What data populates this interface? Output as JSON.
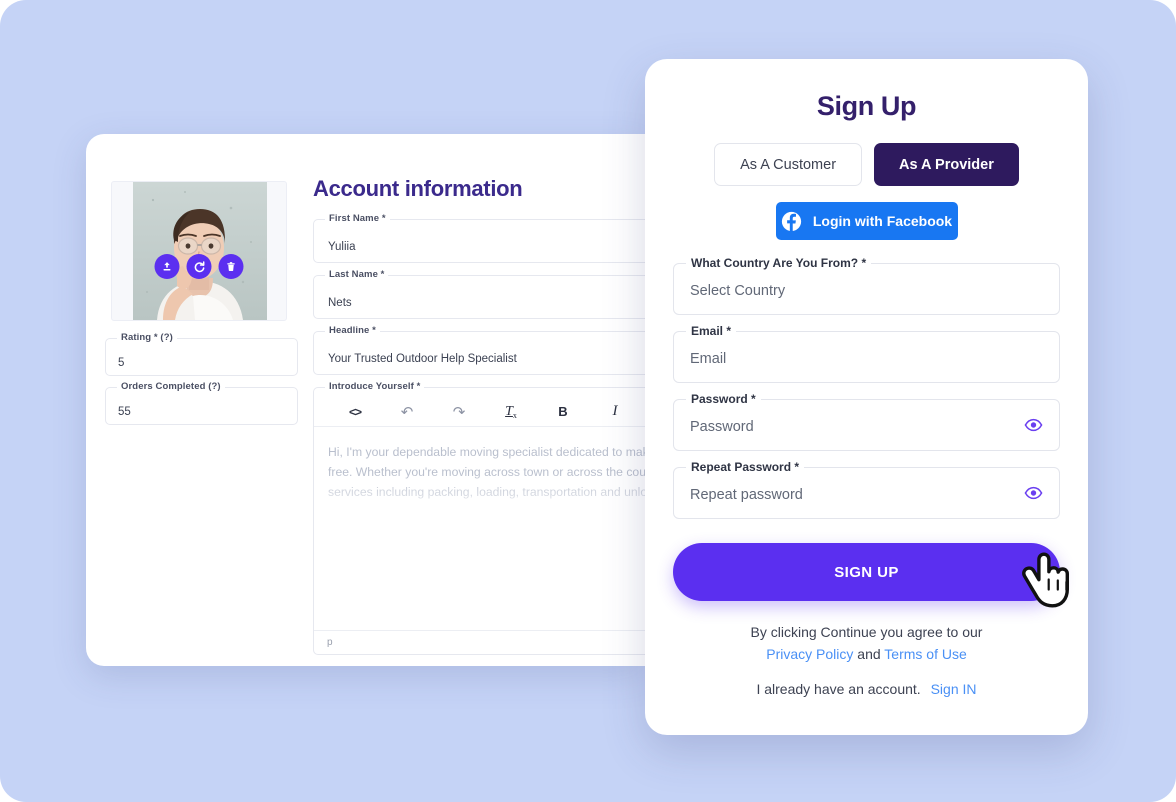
{
  "theme": {
    "backdrop": "#c5d3f6",
    "accent_purple": "#5b2ff0",
    "dark_indigo": "#2e1a5e",
    "title_indigo": "#34206b",
    "facebook_blue": "#1877f2",
    "link_blue": "#4a90f5"
  },
  "back_card": {
    "title": "Account information",
    "avatar": {
      "alt": "profile-photo",
      "actions": [
        {
          "name": "upload-photo-button",
          "icon": "upload-icon"
        },
        {
          "name": "rotate-photo-button",
          "icon": "rotate-icon"
        },
        {
          "name": "delete-photo-button",
          "icon": "trash-icon"
        }
      ]
    },
    "left_fields": [
      {
        "label": "Rating * (?)",
        "value": "5"
      },
      {
        "label": "Orders Completed (?)",
        "value": "55"
      }
    ],
    "right_fields": [
      {
        "label": "First Name *",
        "value": "Yuliia"
      },
      {
        "label": "Last Name *",
        "value": "Nets"
      },
      {
        "label": "Headline *",
        "value": "Your Trusted Outdoor Help Specialist"
      }
    ],
    "editor": {
      "label": "Introduce Yourself *",
      "toolbar": [
        {
          "name": "source-code-button",
          "glyph": "<>"
        },
        {
          "name": "undo-button",
          "glyph": "↶"
        },
        {
          "name": "redo-button",
          "glyph": "↷"
        },
        {
          "name": "remove-format-button",
          "glyph": "Ix"
        },
        {
          "name": "bold-button",
          "glyph": "B"
        },
        {
          "name": "italic-button",
          "glyph": "I"
        }
      ],
      "placeholder": "Hi, I'm your dependable moving specialist dedicated to making your move smooth and stress-free. Whether you're moving across town or across the country, I offer comprehensive moving services including packing, loading, transportation and unloading.",
      "status": "p"
    }
  },
  "front_card": {
    "title": "Sign Up",
    "role_tabs": [
      {
        "label": "As A Customer",
        "active": false
      },
      {
        "label": "As A Provider",
        "active": true
      }
    ],
    "facebook_button": "Login with Facebook",
    "fields": [
      {
        "name": "country-select",
        "label": "What Country Are You From? *",
        "value": "Select Country",
        "has_eye": false
      },
      {
        "name": "email-field",
        "label": "Email *",
        "value": "Email",
        "has_eye": false
      },
      {
        "name": "password-field",
        "label": "Password *",
        "value": "Password",
        "has_eye": true
      },
      {
        "name": "repeat-password-field",
        "label": "Repeat Password *",
        "value": "Repeat password",
        "has_eye": true
      }
    ],
    "submit_label": "SIGN UP",
    "legal_line1": "By clicking Continue you agree to our",
    "legal_privacy": "Privacy Policy",
    "legal_and": "and",
    "legal_terms": "Terms of Use",
    "account_text": "I already have an account.",
    "signin_link": "Sign IN"
  }
}
